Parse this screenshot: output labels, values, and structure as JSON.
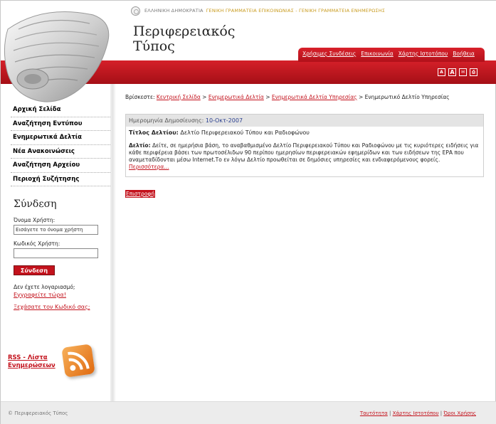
{
  "header": {
    "gov_text": "ΕΛΛΗΝΙΚΗ ΔΗΜΟΚΡΑΤΙΑ",
    "gov_secretariat": "ΓΕΝΙΚΗ ΓΡΑΜΜΑΤΕΙΑ ΕΠΙΚΟΙΝΩΝΙΑΣ - ΓΕΝΙΚΗ ΓΡΑΜΜΑΤΕΙΑ ΕΝΗΜΕΡΩΣΗΣ",
    "site_title_line1": "Περιφερειακός",
    "site_title_line2": "Τύπος",
    "nav": [
      {
        "label": "Χρήσιμες Συνδέσεις"
      },
      {
        "label": "Επικοινωνία"
      },
      {
        "label": "Χάρτης Ιστοτόπου"
      },
      {
        "label": "Βοήθεια"
      }
    ],
    "tool_icons": [
      "A",
      "A",
      "✉",
      "⎙"
    ]
  },
  "sidebar": {
    "menu": [
      {
        "label": "Αρχική Σελίδα"
      },
      {
        "label": "Αναζήτηση Εντύπου"
      },
      {
        "label": "Ενημερωτικά Δελτία"
      },
      {
        "label": "Νέα Ανακοινώσεις"
      },
      {
        "label": "Αναζήτηση Αρχείου"
      },
      {
        "label": "Περιοχή Συζήτησης"
      }
    ],
    "login": {
      "title": "Σύνδεση",
      "username_label": "Όνομα Χρήστη:",
      "username_value": "Εισάγετε το όνομα χρήστη",
      "password_label": "Κωδικός Χρήστη:",
      "submit_label": "Σύνδεση",
      "no_account_text": "Δεν έχετε λογαριασμό;",
      "register_link": "Εγγραφείτε τώρα!",
      "forgot_link": "Ξεχάσατε τον Κωδικό σας;"
    },
    "rss_line1": "RSS - Λίστα",
    "rss_line2": "Ενημερώσεων"
  },
  "breadcrumb": {
    "label": "Βρίσκεστε:",
    "items": [
      {
        "label": "Κεντρική Σελίδα",
        "link": true
      },
      {
        "label": "Ενημερωτικά Δελτία",
        "link": true
      },
      {
        "label": "Ενημερωτικά Δελτία Υπηρεσίας",
        "link": true
      },
      {
        "label": "Ενημερωτικό Δελτίο Υπηρεσίας",
        "link": false
      }
    ],
    "separator": ">"
  },
  "news": {
    "date_label": "Ημερομηνία Δημοσίευσης:",
    "date_value": "10-Οκτ-2007",
    "title_label": "Τίτλος Δελτίου:",
    "title_value": "Δελτίο Περιφερειακού Τύπου και Ραδιοφώνου",
    "desc_label": "Δελτίο:",
    "desc_text": "Δείτε, σε ημερήσια βάση, το αναβαθμισμένο Δελτίο Περιφερειακού Τύπου και Ραδιοφώνου με τις κυριότερες ειδήσεις για κάθε περιφέρεια βάσει των πρωτοσέλιδων 90 περίπου ημερησίων περιφερειακών εφημερίδων και των ειδήσεων της ΕΡΑ που αναμεταδίδονται μέσω Internet.Το εν λόγω Δελτίο προωθείται σε δημόσιες υπηρεσίες και ενδιαφερόμενους φορείς.",
    "more_link": "Περισσότερα..."
  },
  "back_label": "Επιστροφή",
  "footer": {
    "copyright": "© Περιφερειακός Τύπος",
    "links": [
      {
        "label": "Ταυτότητα"
      },
      {
        "label": "Χάρτης Ιστοτόπου"
      },
      {
        "label": "Όροι Χρήσης"
      }
    ],
    "separator": "|"
  },
  "colors": {
    "accent": "#c3121c",
    "band": "#a50f16",
    "date_blue": "#2a3f8f"
  }
}
